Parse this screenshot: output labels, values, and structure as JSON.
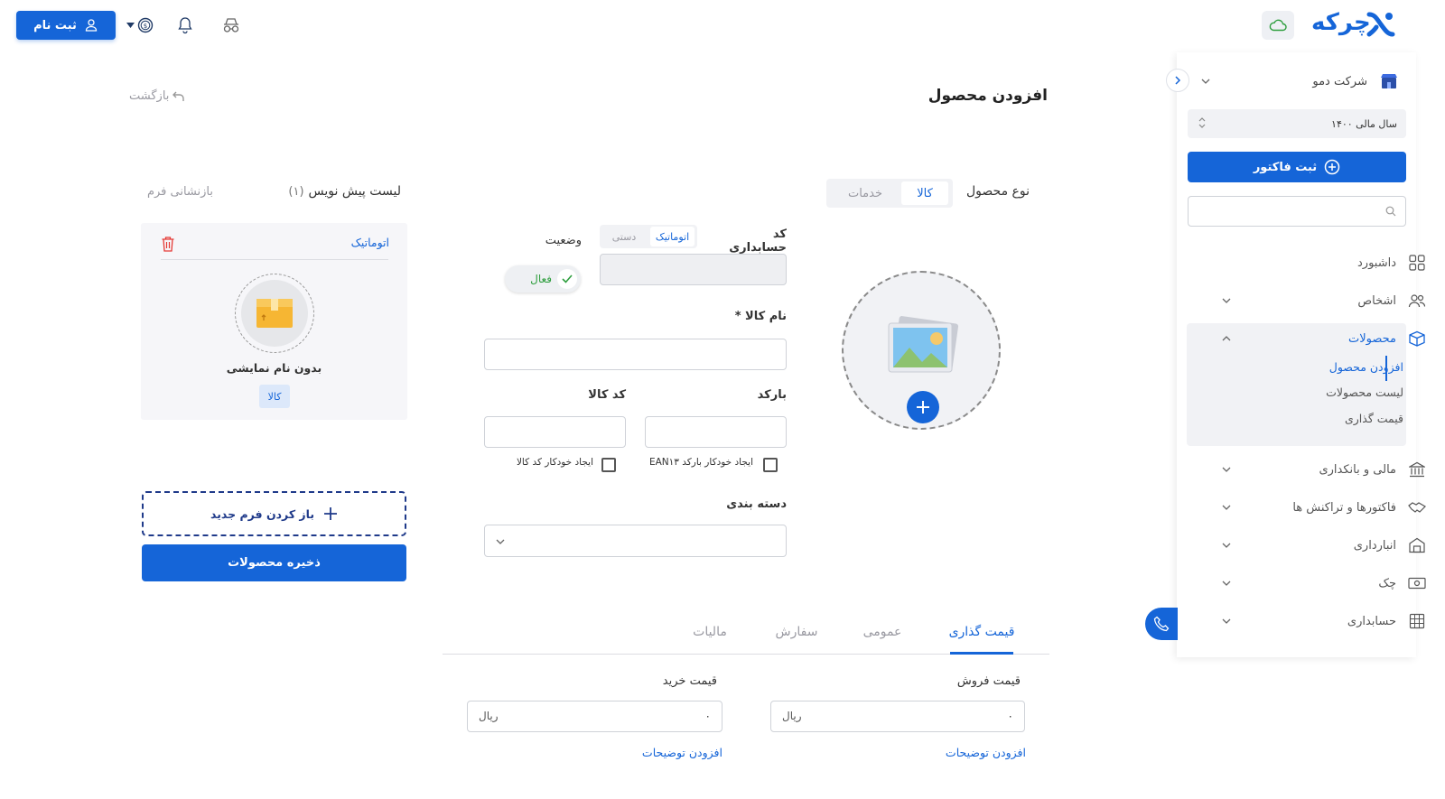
{
  "topbar": {
    "signup_label": "ثبت نام",
    "logo_text": "چرکه"
  },
  "sidebar": {
    "company": "شرکت دمو",
    "fiscal_year": "سال مالی ۱۴۰۰",
    "invoice_button": "ثبت فاکتور",
    "search_placeholder": "",
    "items": [
      {
        "label": "داشبورد",
        "icon": "dashboard-icon"
      },
      {
        "label": "اشخاص",
        "icon": "people-icon"
      },
      {
        "label": "محصولات",
        "icon": "box-icon"
      },
      {
        "label": "مالی و بانکداری",
        "icon": "bank-icon"
      },
      {
        "label": "فاکتورها و تراکنش ها",
        "icon": "handshake-icon"
      },
      {
        "label": "انبارداری",
        "icon": "warehouse-icon"
      },
      {
        "label": "چک",
        "icon": "cheque-icon"
      },
      {
        "label": "حسابداری",
        "icon": "calculator-icon"
      }
    ],
    "products_sub": [
      "افزودن محصول",
      "لیست محصولات",
      "قیمت گذاری"
    ]
  },
  "page": {
    "title": "افزودن محصول",
    "back": "بازگشت",
    "product_type_label": "نوع محصول",
    "type_tabs": [
      "کالا",
      "خدمات"
    ],
    "accounting_code_label": "کد حسابداری",
    "code_modes": [
      "اتوماتیک",
      "دستی"
    ],
    "status_label": "وضعیت",
    "status_value": "فعال",
    "name_label": "نام کالا *",
    "barcode_label": "بارکد",
    "product_code_label": "کد کالا",
    "auto_barcode": "ایجاد خودکار بارکد EAN۱۳",
    "auto_code": "ایجاد خودکار کد کالا",
    "category_label": "دسته بندی"
  },
  "drafts": {
    "title": "لیست پیش نویس",
    "count": "(۱)",
    "reset": "بازنشانی فرم",
    "card_code": "اتوماتیک",
    "card_name": "بدون نام نمایشی",
    "card_badge": "کالا",
    "open_new": "باز کردن فرم جدید",
    "save": "ذخیره محصولات"
  },
  "bottom_tabs": [
    "قیمت گذاری",
    "عمومی",
    "سفارش",
    "مالیات"
  ],
  "pricing": {
    "sell_label": "قیمت فروش",
    "buy_label": "قیمت خرید",
    "sell_value": "۰",
    "buy_value": "۰",
    "currency": "ریال",
    "add_desc": "افزودن توضیحات"
  },
  "colors": {
    "primary": "#1565d8",
    "success": "#2e9e3e",
    "danger": "#e53935"
  }
}
